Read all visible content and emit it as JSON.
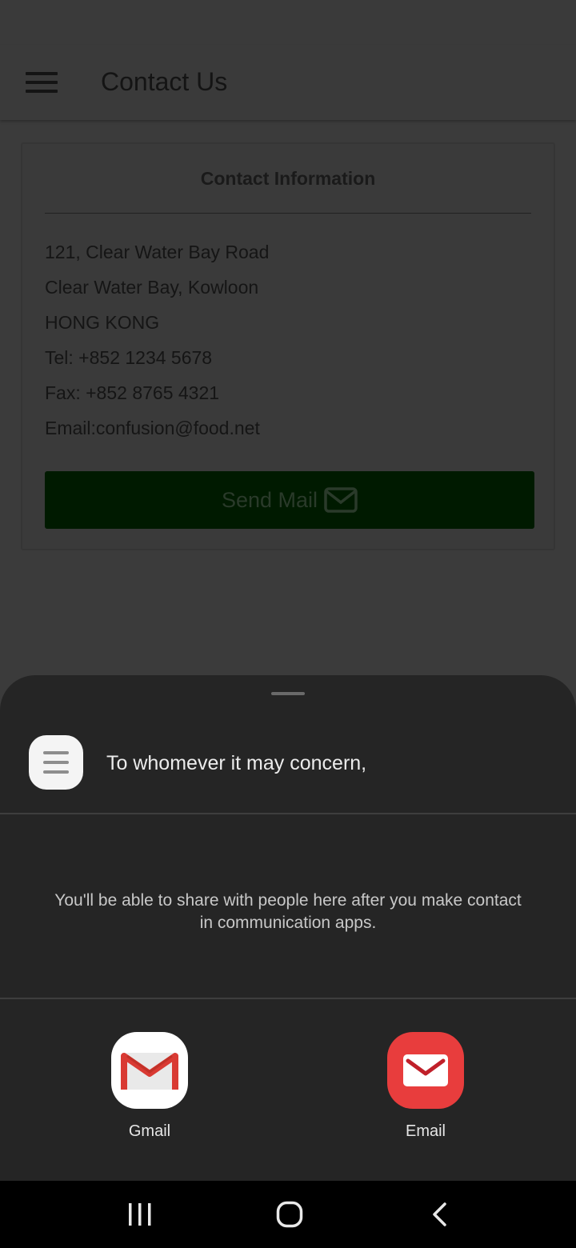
{
  "appbar": {
    "title": "Contact Us",
    "menu_icon": "hamburger-menu-icon"
  },
  "contact_card": {
    "title": "Contact Information",
    "lines": [
      "121, Clear Water Bay Road",
      "Clear Water Bay, Kowloon",
      "HONG KONG",
      "Tel: +852 1234 5678",
      "Fax: +852 8765 4321",
      "Email:confusion@food.net"
    ],
    "send_button": {
      "label": "Send Mail",
      "icon": "envelope-icon"
    }
  },
  "share_sheet": {
    "preview_text": "To whomever it may concern,",
    "preview_icon": "document-lines-icon",
    "direct_share_message": "You'll be able to share with people here after you make contact in communication apps.",
    "apps": [
      {
        "label": "Gmail",
        "icon": "gmail-icon"
      },
      {
        "label": "Email",
        "icon": "email-app-icon"
      }
    ]
  },
  "navigation": {
    "recents": "recents-icon",
    "home": "home-icon",
    "back": "back-icon"
  },
  "colors": {
    "sheet_bg": "#252525",
    "send_button_bg": "#001a00",
    "email_app_red": "#e83d3d",
    "gmail_red": "#d93a33"
  }
}
